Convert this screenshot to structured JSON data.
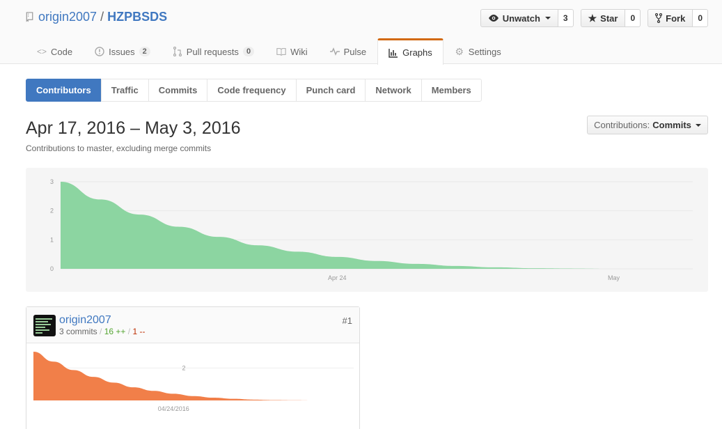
{
  "repo": {
    "owner": "origin2007",
    "separator": "/",
    "name": "HZPBSDS"
  },
  "actions": {
    "watch_label": "Unwatch",
    "watch_count": "3",
    "star_label": "Star",
    "star_count": "0",
    "fork_label": "Fork",
    "fork_count": "0"
  },
  "nav": {
    "code": "Code",
    "issues": "Issues",
    "issues_count": "2",
    "pulls": "Pull requests",
    "pulls_count": "0",
    "wiki": "Wiki",
    "pulse": "Pulse",
    "graphs": "Graphs",
    "settings": "Settings"
  },
  "subnav": {
    "contributors": "Contributors",
    "traffic": "Traffic",
    "commits": "Commits",
    "code_frequency": "Code frequency",
    "punch_card": "Punch card",
    "network": "Network",
    "members": "Members"
  },
  "page": {
    "range_title": "Apr 17, 2016 – May 3, 2016",
    "range_subtitle": "Contributions to master, excluding merge commits",
    "contrib_label": "Contributions:",
    "contrib_value": "Commits"
  },
  "contributor": {
    "name": "origin2007",
    "commits": "3 commits",
    "stat_sep": "/",
    "additions": "16 ++",
    "deletions": "1 --",
    "rank": "#1"
  },
  "colors": {
    "main_area": "#8cd5a1",
    "contributor_area": "#f17f49",
    "accent": "#4078c0",
    "tab_top": "#d26911"
  },
  "chart_data": [
    {
      "type": "area",
      "x": [
        "2016-04-17",
        "2016-04-18",
        "2016-04-19",
        "2016-04-20",
        "2016-04-21",
        "2016-04-22",
        "2016-04-23",
        "2016-04-24",
        "2016-04-25",
        "2016-04-26",
        "2016-04-27",
        "2016-04-28",
        "2016-04-29",
        "2016-04-30",
        "2016-05-01",
        "2016-05-02",
        "2016-05-03"
      ],
      "values": [
        3,
        2.39,
        1.87,
        1.45,
        1.1,
        0.81,
        0.59,
        0.41,
        0.27,
        0.17,
        0.1,
        0.05,
        0.02,
        0.01,
        0,
        0,
        0
      ],
      "yticks": [
        "0",
        "1",
        "2",
        "3"
      ],
      "ylim": [
        0,
        3
      ],
      "xticks": [
        {
          "label": "Apr 24",
          "x": "2016-04-24"
        },
        {
          "label": "May",
          "x": "2016-05-01"
        }
      ],
      "grid": true
    },
    {
      "type": "area",
      "x": [
        "2016-04-17",
        "2016-04-18",
        "2016-04-19",
        "2016-04-20",
        "2016-04-21",
        "2016-04-22",
        "2016-04-23",
        "2016-04-24",
        "2016-04-25",
        "2016-04-26",
        "2016-04-27",
        "2016-04-28",
        "2016-04-29",
        "2016-04-30",
        "2016-05-01",
        "2016-05-02",
        "2016-05-03"
      ],
      "values": [
        3,
        2.39,
        1.87,
        1.45,
        1.1,
        0.81,
        0.59,
        0.41,
        0.27,
        0.17,
        0.1,
        0.05,
        0.02,
        0.01,
        0,
        0,
        0
      ],
      "yticks": [
        "2"
      ],
      "ylim": [
        0,
        3
      ],
      "xticks": [
        {
          "label": "04/24/2016",
          "x": "2016-04-24"
        }
      ],
      "grid": true
    }
  ]
}
